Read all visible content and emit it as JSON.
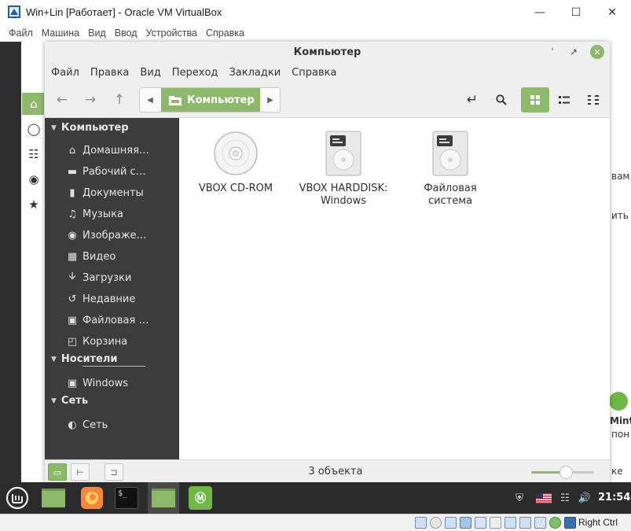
{
  "host": {
    "title": "Win+Lin [Работает] - Oracle VM VirtualBox",
    "menu": [
      "Файл",
      "Машина",
      "Вид",
      "Ввод",
      "Устройства",
      "Справка"
    ],
    "right_ctrl": "Right Ctrl"
  },
  "background_window": {
    "fragments": [
      "вам,",
      "ить в",
      "Mint",
      "пон",
      "ке"
    ]
  },
  "nemo": {
    "title": "Компьютер",
    "menu": [
      "Файл",
      "Правка",
      "Вид",
      "Переход",
      "Закладки",
      "Справка"
    ],
    "path_crumb": "Компьютер",
    "sidebar": {
      "sections": [
        {
          "header": "Компьютер",
          "items": [
            {
              "label": "Домашняя…",
              "icon": "home-icon"
            },
            {
              "label": "Рабочий с…",
              "icon": "desktop-icon"
            },
            {
              "label": "Документы",
              "icon": "document-icon"
            },
            {
              "label": "Музыка",
              "icon": "music-icon"
            },
            {
              "label": "Изображе…",
              "icon": "camera-icon"
            },
            {
              "label": "Видео",
              "icon": "video-icon"
            },
            {
              "label": "Загрузки",
              "icon": "download-icon"
            },
            {
              "label": "Недавние",
              "icon": "history-icon"
            },
            {
              "label": "Файловая …",
              "icon": "harddisk-icon"
            },
            {
              "label": "Корзина",
              "icon": "trash-icon"
            }
          ]
        },
        {
          "header": "Носители",
          "items": [
            {
              "label": "Windows",
              "icon": "harddisk-icon"
            }
          ]
        },
        {
          "header": "Сеть",
          "items": [
            {
              "label": "Сеть",
              "icon": "network-icon"
            }
          ]
        }
      ]
    },
    "items": [
      {
        "label": "VBOX CD-ROM",
        "icon": "cdrom-icon"
      },
      {
        "label": "VBOX HARDDISK: Windows",
        "icon": "harddisk-icon"
      },
      {
        "label": "Файловая система",
        "icon": "harddisk-icon"
      }
    ],
    "status": "3 объекта",
    "zoom_level": 0.55
  },
  "taskbar": {
    "clock": "21:54"
  },
  "colors": {
    "accent": "#8fb96a",
    "sidebar_bg": "#3c3c3c",
    "taskbar_bg": "#2b2b2b"
  }
}
